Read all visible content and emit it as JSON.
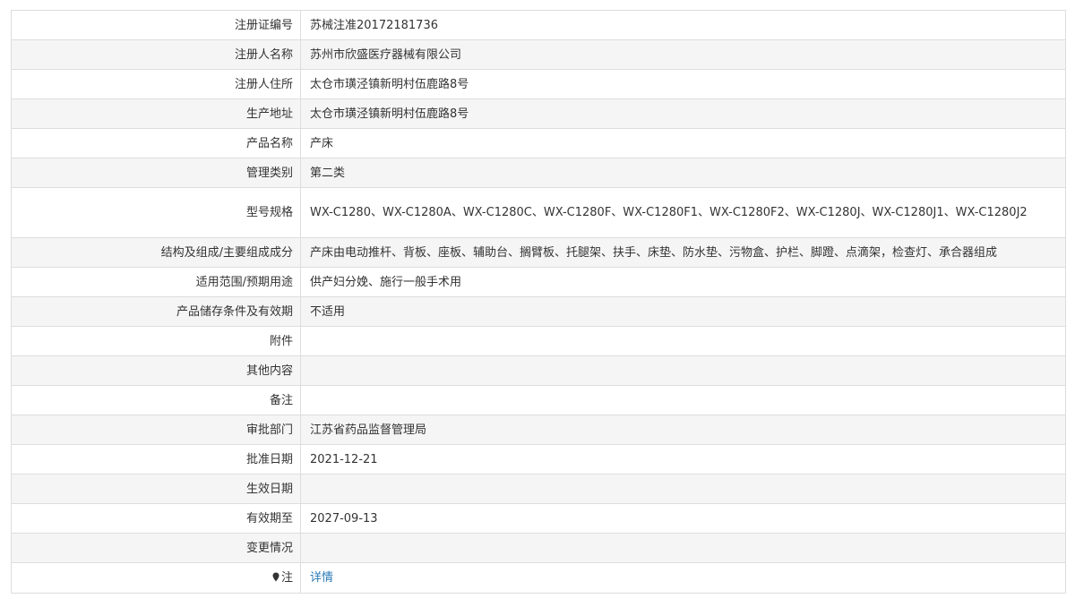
{
  "rows": [
    {
      "label": "注册证编号",
      "value": "苏械注准20172181736"
    },
    {
      "label": "注册人名称",
      "value": "苏州市欣盛医疗器械有限公司"
    },
    {
      "label": "注册人住所",
      "value": "太仓市璜泾镇新明村伍鹿路8号"
    },
    {
      "label": "生产地址",
      "value": "太仓市璜泾镇新明村伍鹿路8号"
    },
    {
      "label": "产品名称",
      "value": "产床"
    },
    {
      "label": "管理类别",
      "value": "第二类"
    },
    {
      "label": "型号规格",
      "value": "WX-C1280、WX-C1280A、WX-C1280C、WX-C1280F、WX-C1280F1、WX-C1280F2、WX-C1280J、WX-C1280J1、WX-C1280J2"
    },
    {
      "label": "结构及组成/主要组成成分",
      "value": "产床由电动推杆、背板、座板、辅助台、搁臂板、托腿架、扶手、床垫、防水垫、污物盒、护栏、脚蹬、点滴架，检查灯、承合器组成"
    },
    {
      "label": "适用范围/预期用途",
      "value": "供产妇分娩、施行一般手术用"
    },
    {
      "label": "产品储存条件及有效期",
      "value": "不适用"
    },
    {
      "label": "附件",
      "value": ""
    },
    {
      "label": "其他内容",
      "value": ""
    },
    {
      "label": "备注",
      "value": ""
    },
    {
      "label": "审批部门",
      "value": "江苏省药品监督管理局"
    },
    {
      "label": "批准日期",
      "value": "2021-12-21"
    },
    {
      "label": "生效日期",
      "value": ""
    },
    {
      "label": "有效期至",
      "value": "2027-09-13"
    },
    {
      "label": "变更情况",
      "value": ""
    }
  ],
  "note": {
    "label": "注",
    "icon": "pin-icon",
    "link_text": "详情"
  },
  "colors": {
    "border": "#dddddd",
    "stripe": "#f5f5f5",
    "link": "#2a7ab8"
  }
}
